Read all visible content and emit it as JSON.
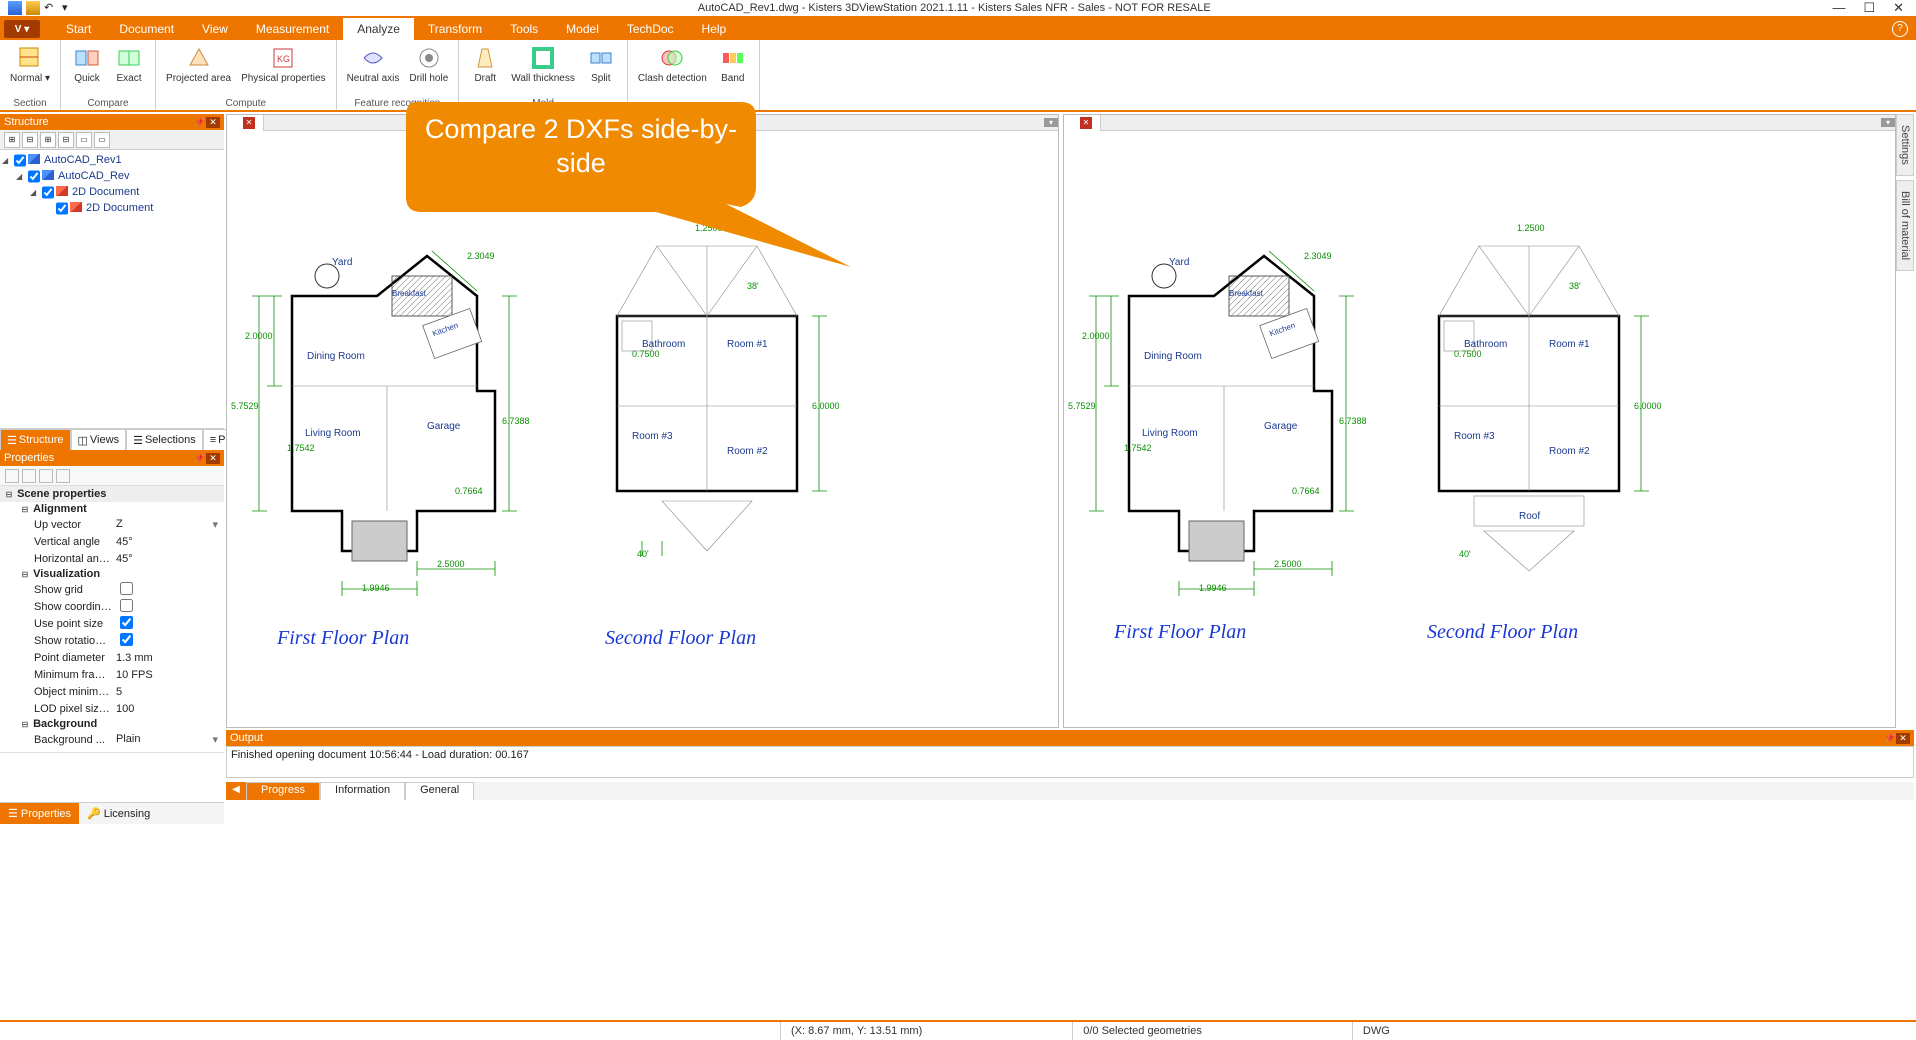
{
  "window": {
    "title": "AutoCAD_Rev1.dwg - Kisters 3DViewStation 2021.1.11 - Kisters Sales NFR - Sales - NOT FOR RESALE"
  },
  "ribbon": {
    "app_button": "V ▾",
    "tabs": [
      "Start",
      "Document",
      "View",
      "Measurement",
      "Analyze",
      "Transform",
      "Tools",
      "Model",
      "TechDoc",
      "Help"
    ],
    "active_tab": "Analyze",
    "groups": {
      "section": {
        "label": "Section",
        "items": [
          "Normal ▾"
        ]
      },
      "compare": {
        "label": "Compare",
        "items": [
          "Quick",
          "Exact"
        ]
      },
      "compute": {
        "label": "Compute",
        "items": [
          "Projected area",
          "Physical properties"
        ]
      },
      "feature": {
        "label": "Feature recognition",
        "items": [
          "Neutral axis",
          "Drill hole"
        ]
      },
      "mold": {
        "label": "Mold",
        "items": [
          "Draft",
          "Wall thickness",
          "Split"
        ]
      },
      "clash": {
        "label": "",
        "items": [
          "Clash detection",
          "Band"
        ]
      }
    }
  },
  "callout_text": "Compare 2 DXFs side-by-side",
  "panels": {
    "structure": {
      "title": "Structure"
    },
    "properties": {
      "title": "Properties"
    },
    "output": {
      "title": "Output"
    }
  },
  "structure_tree": [
    {
      "level": 0,
      "label": "AutoCAD_Rev1",
      "icon": "blue",
      "expanded": true,
      "checked": true
    },
    {
      "level": 1,
      "label": "AutoCAD_Rev",
      "icon": "blue",
      "expanded": true,
      "checked": true
    },
    {
      "level": 2,
      "label": "2D Document",
      "icon": "red",
      "expanded": true,
      "checked": true
    },
    {
      "level": 3,
      "label": "2D Document",
      "icon": "red",
      "expanded": false,
      "checked": true
    }
  ],
  "structure_tabs": [
    "Structure",
    "Views",
    "Selections",
    "Profiles"
  ],
  "properties": {
    "section1": "Scene properties",
    "alignment": {
      "label": "Alignment",
      "up_vector_key": "Up vector",
      "up_vector_val": "Z",
      "vertical_angle_key": "Vertical angle",
      "vertical_angle_val": "45°",
      "horizontal_angle_key": "Horizontal angle",
      "horizontal_angle_val": "45°"
    },
    "visualization": {
      "label": "Visualization",
      "show_grid_key": "Show grid",
      "show_grid_val": false,
      "show_coord_key": "Show coordinat...",
      "show_coord_val": false,
      "use_point_size_key": "Use point size",
      "use_point_size_val": true,
      "show_rotation_key": "Show rotation c...",
      "show_rotation_val": true,
      "point_diameter_key": "Point diameter",
      "point_diameter_val": "1.3 mm",
      "min_framerate_key": "Minimum fram...",
      "min_framerate_val": "10 FPS",
      "object_min_key": "Object minimu...",
      "object_min_val": "5",
      "lod_pixel_key": "LOD pixel size t...",
      "lod_pixel_val": "100"
    },
    "background": {
      "label": "Background",
      "background_key": "Background ...",
      "background_val": "Plain"
    }
  },
  "bottom_left_tabs": [
    "Properties",
    "Licensing"
  ],
  "output_message": "Finished opening document 10:56:44 - Load duration: 00.167",
  "bottom_ribbon_tabs": [
    "Progress",
    "Information",
    "General"
  ],
  "status": {
    "coords": "(X: 8.67 mm, Y: 13.51 mm)",
    "selection": "0/0 Selected geometries",
    "format": "DWG"
  },
  "right_tabs": {
    "settings": "Settings",
    "bom": "Bill of material"
  },
  "floorplan": {
    "first": {
      "title": "First Floor Plan",
      "rooms": {
        "yard": "Yard",
        "breakfast": "Breakfast",
        "kitchen": "Kitchen",
        "dining": "Dining Room",
        "living": "Living Room",
        "garage": "Garage"
      },
      "dims": {
        "w1": "2.0000",
        "w2": "5.7529",
        "w3": "1.7542",
        "w4": "1.9946",
        "h1": "2.3049",
        "h2": "6.7388",
        "h3": "2.5000",
        "h4": "0.7664"
      }
    },
    "second": {
      "title": "Second Floor Plan",
      "rooms": {
        "bath": "Bathroom",
        "r1": "Room #1",
        "r2": "Room #2",
        "r3": "Room #3",
        "roof": "Roof"
      },
      "dims": {
        "d1": "1.2500",
        "d2": "38'",
        "d3": "0.7500",
        "d4": "6.0000",
        "d5": "40'"
      }
    }
  }
}
